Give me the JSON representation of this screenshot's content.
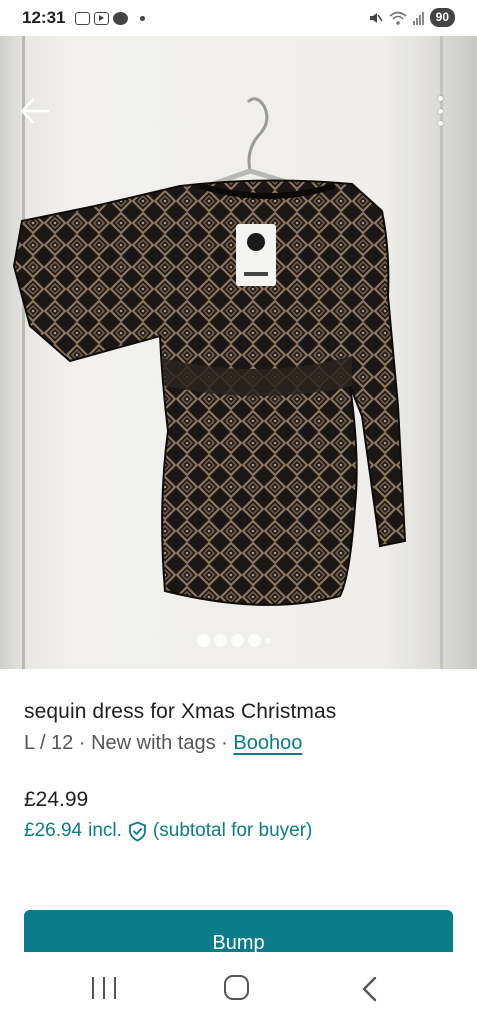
{
  "status_bar": {
    "time": "12:31",
    "battery": "90",
    "icons": [
      "screen-record-icon",
      "youtube-icon",
      "messenger-icon",
      "notification-dot",
      "mute-icon",
      "wifi-icon",
      "signal-icon",
      "battery-icon"
    ]
  },
  "gallery": {
    "image_count": 5,
    "active_index": 0
  },
  "listing": {
    "title": "sequin dress for Xmas Christmas",
    "size": "L / 12",
    "condition": "New with tags",
    "separator": " · ",
    "brand": "Boohoo",
    "price": "£24.99",
    "price_incl": "£26.94",
    "incl_label": "incl.",
    "subtotal_note": "(subtotal for buyer)"
  },
  "actions": {
    "bump_label": "Bump"
  },
  "colors": {
    "accent": "#0b7c8a",
    "text": "#1f1f1f",
    "muted": "#555555"
  }
}
